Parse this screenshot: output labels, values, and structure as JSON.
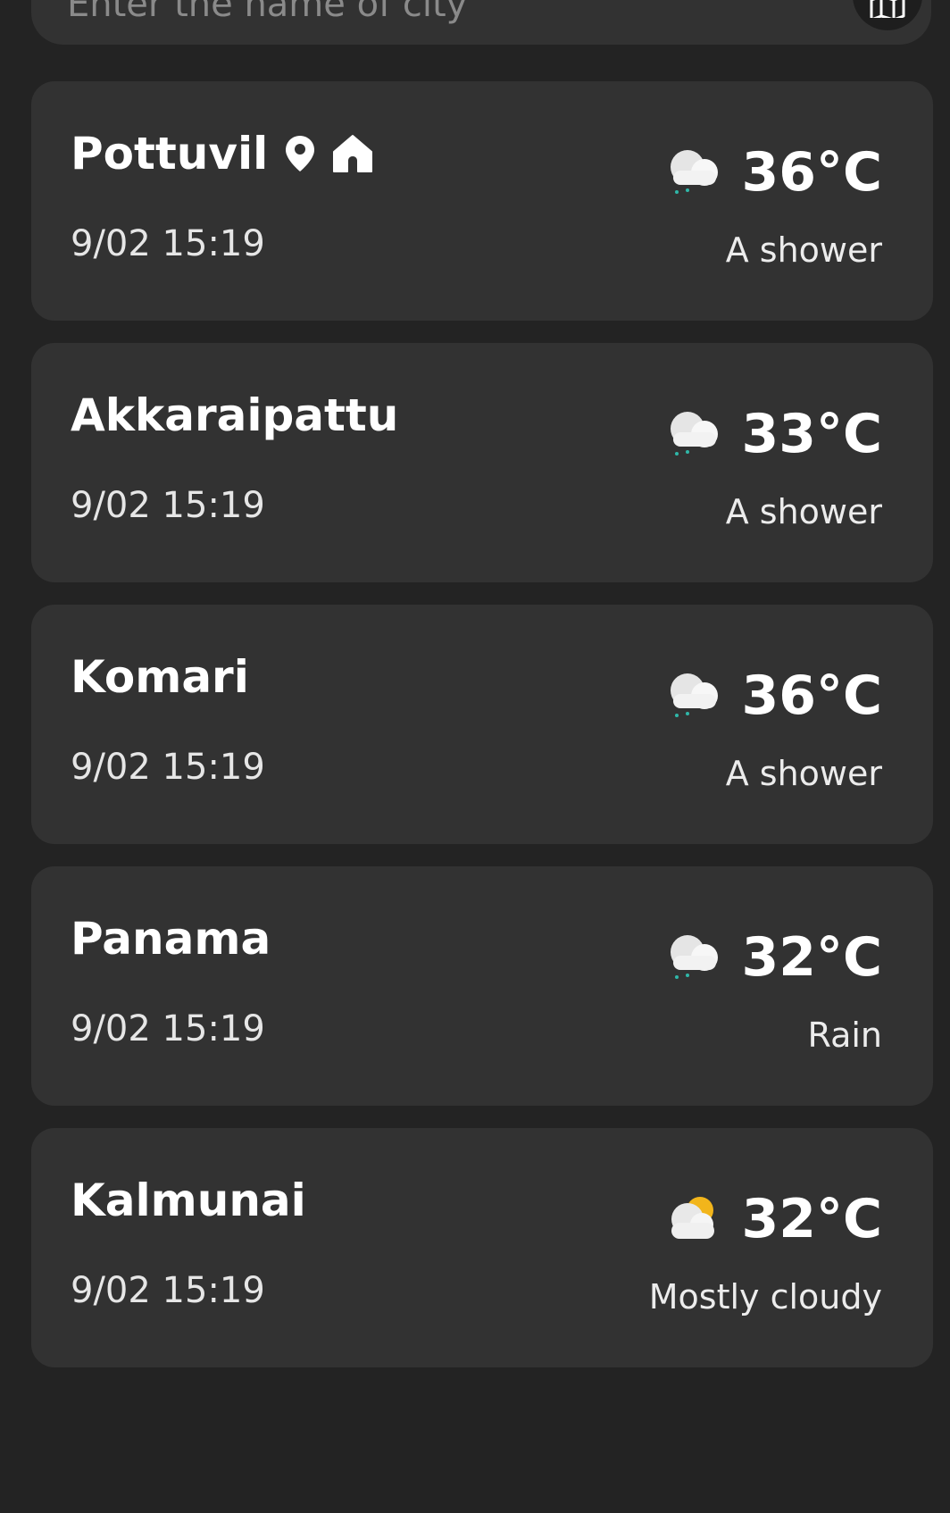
{
  "search": {
    "placeholder": "Enter the name of city",
    "map_icon": "map-icon"
  },
  "cities": [
    {
      "name": "Pottuvil",
      "badges": [
        "location-pin-icon",
        "home-icon"
      ],
      "date": "9/02",
      "time": "15:19",
      "temperature": "36°C",
      "condition": "A shower",
      "weather_icon": "shower-cloud-icon"
    },
    {
      "name": "Akkaraipattu",
      "badges": [],
      "date": "9/02",
      "time": "15:19",
      "temperature": "33°C",
      "condition": "A shower",
      "weather_icon": "shower-cloud-icon"
    },
    {
      "name": "Komari",
      "badges": [],
      "date": "9/02",
      "time": "15:19",
      "temperature": "36°C",
      "condition": "A shower",
      "weather_icon": "shower-cloud-icon"
    },
    {
      "name": "Panama",
      "badges": [],
      "date": "9/02",
      "time": "15:19",
      "temperature": "32°C",
      "condition": "Rain",
      "weather_icon": "shower-cloud-icon"
    },
    {
      "name": "Kalmunai",
      "badges": [],
      "date": "9/02",
      "time": "15:19",
      "temperature": "32°C",
      "condition": "Mostly cloudy",
      "weather_icon": "mostly-cloudy-icon"
    }
  ],
  "colors": {
    "background": "#232323",
    "card": "#323232",
    "text": "#ffffff",
    "sun": "#f2b51b",
    "rain_drop": "#2fb7a8"
  }
}
